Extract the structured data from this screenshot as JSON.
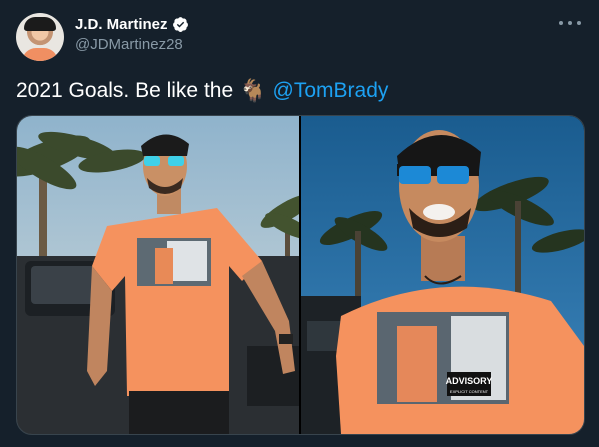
{
  "author": {
    "display_name": "J.D. Martinez",
    "handle": "@JDMartinez28",
    "verified": true
  },
  "tweet": {
    "text_before": "2021 Goals. Be like the",
    "emoji": "🐐",
    "emoji_name": "goat-icon",
    "mention": "@TomBrady"
  },
  "media": {
    "count": 2,
    "shirt_print_label": "ADVISORY",
    "shirt_print_sublabel": "EXPLICIT CONTENT"
  },
  "colors": {
    "background": "#15202b",
    "secondary_text": "#8899a6",
    "link": "#1da1f2",
    "shirt_orange": "#f5925e"
  }
}
